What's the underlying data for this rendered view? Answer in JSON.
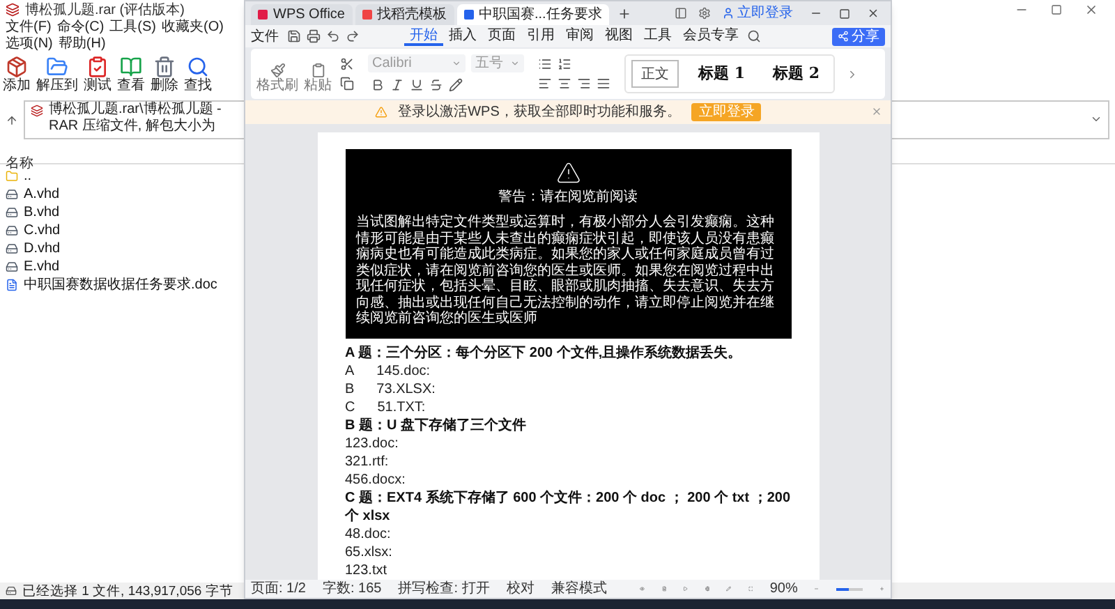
{
  "winrar": {
    "title": "博松孤儿题.rar (评估版本)",
    "menu": [
      "文件(F)",
      "命令(C)",
      "工具(S)",
      "收藏夹(O)",
      "选项(N)",
      "帮助(H)"
    ],
    "toolbar": [
      {
        "label": "添加",
        "kind": "add"
      },
      {
        "label": "解压到",
        "kind": "extract"
      },
      {
        "label": "测试",
        "kind": "test"
      },
      {
        "label": "查看",
        "kind": "view"
      },
      {
        "label": "删除",
        "kind": "delete"
      },
      {
        "label": "查找",
        "kind": "find"
      }
    ],
    "address": "博松孤儿题.rar\\博松孤儿题 - RAR 压缩文件, 解包大小为",
    "column": "名称",
    "files": [
      {
        "name": "..",
        "kind": "folder"
      },
      {
        "name": "A.vhd",
        "kind": "disk"
      },
      {
        "name": "B.vhd",
        "kind": "disk"
      },
      {
        "name": "C.vhd",
        "kind": "disk"
      },
      {
        "name": "D.vhd",
        "kind": "disk"
      },
      {
        "name": "E.vhd",
        "kind": "disk"
      },
      {
        "name": "中职国赛数据收据任务要求.doc",
        "kind": "doc"
      }
    ],
    "status": "已经选择 1 文件, 143,917,056 字节"
  },
  "wps": {
    "tabs": [
      {
        "label": "WPS Office",
        "kind": "home",
        "selected": false
      },
      {
        "label": "找稻壳模板",
        "kind": "template",
        "selected": false
      },
      {
        "label": "中职国赛...任务要求",
        "kind": "doc",
        "selected": true
      }
    ],
    "login": "立即登录",
    "file_menu": "文件",
    "ribbon_tabs": [
      {
        "label": "开始",
        "selected": true
      },
      {
        "label": "插入",
        "selected": false
      },
      {
        "label": "页面",
        "selected": false
      },
      {
        "label": "引用",
        "selected": false
      },
      {
        "label": "审阅",
        "selected": false
      },
      {
        "label": "视图",
        "selected": false
      },
      {
        "label": "工具",
        "selected": false
      },
      {
        "label": "会员专享",
        "selected": false
      }
    ],
    "share": "分享",
    "clipboard": [
      "格式刷",
      "粘贴"
    ],
    "font": "Calibri",
    "font_size": "五号",
    "styles": [
      {
        "label": "正文",
        "selected": true
      },
      {
        "label": "标题 1",
        "selected": false
      },
      {
        "label": "标题 2",
        "selected": false
      }
    ],
    "notice": {
      "text": "登录以激活WPS，获取全部即时功能和服务。",
      "button": "立即登录"
    },
    "document": {
      "warning": {
        "title": "警告：请在阅览前阅读",
        "body": "当试图解出特定文件类型或运算时，有极小部分人会引发癫痫。这种情形可能是由于某些人未查出的癫痫症状引起，即使该人员没有患癫痫病史也有可能造成此类病症。如果您的家人或任何家庭成员曾有过类似症状，请在阅览前咨询您的医生或医师。如果您在阅览过程中出现任何症状，包括头晕、目眩、眼部或肌肉抽搐、失去意识、失去方向感、抽出或出现任何自己无法控制的动作，请立即停止阅览并在继续阅览前咨询您的医生或医师"
      },
      "lines": [
        {
          "kind": "heading",
          "text": "A 题：三个分区：每个分区下 200 个文件,且操作系统数据丢失。"
        },
        {
          "kind": "option",
          "marker": "A",
          "text": "145.doc:"
        },
        {
          "kind": "option",
          "marker": "B",
          "text": "73.XLSX:"
        },
        {
          "kind": "option",
          "marker": "C",
          "text": "51.TXT:"
        },
        {
          "kind": "heading",
          "text": "B 题：U 盘下存储了三个文件"
        },
        {
          "kind": "plain",
          "text": "123.doc:"
        },
        {
          "kind": "plain",
          "text": "321.rtf:"
        },
        {
          "kind": "plain",
          "text": "456.docx:"
        },
        {
          "kind": "heading",
          "text": "C 题：EXT4 系统下存储了 600 个文件：200 个 doc ； 200 个 txt ；200 个 xlsx"
        },
        {
          "kind": "plain",
          "text": "48.doc:"
        },
        {
          "kind": "plain",
          "text": "65.xlsx:"
        },
        {
          "kind": "plain",
          "text": "123.txt"
        }
      ]
    },
    "status": {
      "items": [
        "页面: 1/2",
        "字数: 165",
        "拼写检查: 打开",
        "校对",
        "兼容模式"
      ],
      "zoom": "90%",
      "level": 0.45
    }
  }
}
